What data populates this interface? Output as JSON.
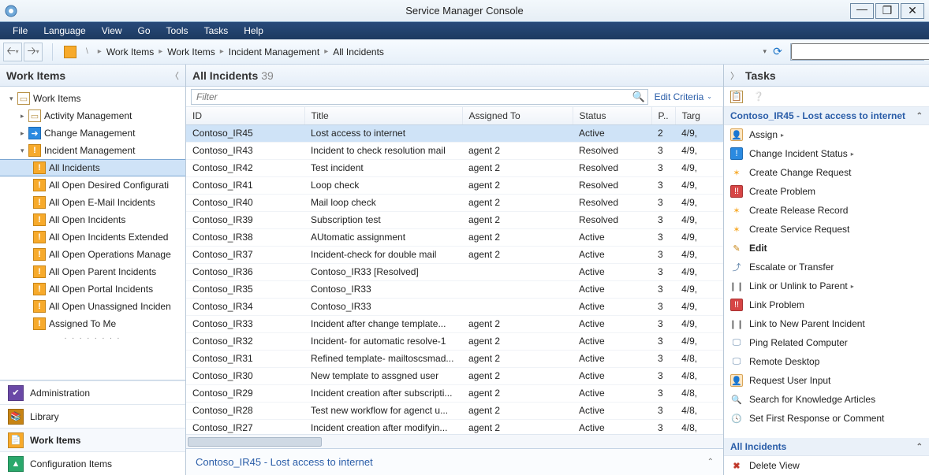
{
  "window": {
    "title": "Service Manager Console"
  },
  "menubar": [
    "File",
    "Language",
    "View",
    "Go",
    "Tools",
    "Tasks",
    "Help"
  ],
  "breadcrumb": [
    "Work Items",
    "Work Items",
    "Incident Management",
    "All Incidents"
  ],
  "leftpane": {
    "title": "Work Items",
    "tree_root": "Work Items",
    "tree_l2": [
      {
        "label": "Activity Management",
        "icon": "folder"
      },
      {
        "label": "Change Management",
        "icon": "blue"
      },
      {
        "label": "Incident Management",
        "icon": "orange"
      }
    ],
    "tree_l3": [
      {
        "label": "All Incidents",
        "selected": true
      },
      {
        "label": "All Open Desired Configurati"
      },
      {
        "label": "All Open E-Mail Incidents"
      },
      {
        "label": "All Open Incidents"
      },
      {
        "label": "All Open Incidents Extended"
      },
      {
        "label": "All Open Operations Manage"
      },
      {
        "label": "All Open Parent Incidents"
      },
      {
        "label": "All Open Portal Incidents"
      },
      {
        "label": "All Open Unassigned Inciden"
      },
      {
        "label": "Assigned To Me"
      }
    ],
    "wunderbar": [
      {
        "label": "Administration",
        "icon": "admin"
      },
      {
        "label": "Library",
        "icon": "library"
      },
      {
        "label": "Work Items",
        "icon": "work",
        "active": true
      },
      {
        "label": "Configuration Items",
        "icon": "config"
      }
    ]
  },
  "center": {
    "title": "All Incidents",
    "count": "39",
    "filter_placeholder": "Filter",
    "edit_criteria": "Edit Criteria",
    "columns": [
      "ID",
      "Title",
      "Assigned To",
      "Status",
      "P..",
      "Targ"
    ],
    "rows": [
      {
        "id": "Contoso_IR45",
        "title": "Lost access to internet",
        "assigned": "",
        "status": "Active",
        "p": "2",
        "targ": "4/9,",
        "sel": true
      },
      {
        "id": "Contoso_IR43",
        "title": "Incident to check resolution mail",
        "assigned": "agent 2",
        "status": "Resolved",
        "p": "3",
        "targ": "4/9,"
      },
      {
        "id": "Contoso_IR42",
        "title": "Test incident",
        "assigned": "agent 2",
        "status": "Resolved",
        "p": "3",
        "targ": "4/9,"
      },
      {
        "id": "Contoso_IR41",
        "title": "Loop check",
        "assigned": "agent 2",
        "status": "Resolved",
        "p": "3",
        "targ": "4/9,"
      },
      {
        "id": "Contoso_IR40",
        "title": "Mail loop check",
        "assigned": "agent 2",
        "status": "Resolved",
        "p": "3",
        "targ": "4/9,"
      },
      {
        "id": "Contoso_IR39",
        "title": "Subscription test",
        "assigned": "agent 2",
        "status": "Resolved",
        "p": "3",
        "targ": "4/9,"
      },
      {
        "id": "Contoso_IR38",
        "title": "AUtomatic assignment",
        "assigned": "agent 2",
        "status": "Active",
        "p": "3",
        "targ": "4/9,"
      },
      {
        "id": "Contoso_IR37",
        "title": "Incident-check for double mail",
        "assigned": "agent 2",
        "status": "Active",
        "p": "3",
        "targ": "4/9,"
      },
      {
        "id": "Contoso_IR36",
        "title": "Contoso_IR33 [Resolved]",
        "assigned": "",
        "status": "Active",
        "p": "3",
        "targ": "4/9,"
      },
      {
        "id": "Contoso_IR35",
        "title": "Contoso_IR33",
        "assigned": "",
        "status": "Active",
        "p": "3",
        "targ": "4/9,"
      },
      {
        "id": "Contoso_IR34",
        "title": "Contoso_IR33",
        "assigned": "",
        "status": "Active",
        "p": "3",
        "targ": "4/9,"
      },
      {
        "id": "Contoso_IR33",
        "title": "Incident after change template...",
        "assigned": "agent 2",
        "status": "Active",
        "p": "3",
        "targ": "4/9,"
      },
      {
        "id": "Contoso_IR32",
        "title": "Incident- for automatic resolve-1",
        "assigned": "agent 2",
        "status": "Active",
        "p": "3",
        "targ": "4/9,"
      },
      {
        "id": "Contoso_IR31",
        "title": "Refined template- mailtoscsmad...",
        "assigned": "agent 2",
        "status": "Active",
        "p": "3",
        "targ": "4/8,"
      },
      {
        "id": "Contoso_IR30",
        "title": "New template to assgned user",
        "assigned": "agent 2",
        "status": "Active",
        "p": "3",
        "targ": "4/8,"
      },
      {
        "id": "Contoso_IR29",
        "title": "Incident creation after subscripti...",
        "assigned": "agent 2",
        "status": "Active",
        "p": "3",
        "targ": "4/8,"
      },
      {
        "id": "Contoso_IR28",
        "title": "Test new workflow for agenct u...",
        "assigned": "agent 2",
        "status": "Active",
        "p": "3",
        "targ": "4/8,"
      },
      {
        "id": "Contoso_IR27",
        "title": "Incident creation after modifyin...",
        "assigned": "agent 2",
        "status": "Active",
        "p": "3",
        "targ": "4/8,"
      }
    ],
    "preview": "Contoso_IR45 - Lost access to internet"
  },
  "tasks": {
    "title": "Tasks",
    "section1_title": "Contoso_IR45 - Lost access to internet",
    "items": [
      {
        "label": "Assign",
        "icon": "user",
        "sub": true
      },
      {
        "label": "Change Incident Status",
        "icon": "info",
        "sub": true
      },
      {
        "label": "Create Change Request",
        "icon": "star"
      },
      {
        "label": "Create Problem",
        "icon": "red"
      },
      {
        "label": "Create Release Record",
        "icon": "star"
      },
      {
        "label": "Create Service Request",
        "icon": "star"
      },
      {
        "label": "Edit",
        "icon": "pencil",
        "bold": true
      },
      {
        "label": "Escalate or Transfer",
        "icon": "up"
      },
      {
        "label": "Link or Unlink to Parent",
        "icon": "link",
        "sub": true
      },
      {
        "label": "Link Problem",
        "icon": "red"
      },
      {
        "label": "Link to New Parent Incident",
        "icon": "link"
      },
      {
        "label": "Ping Related Computer",
        "icon": "monitor"
      },
      {
        "label": "Remote Desktop",
        "icon": "monitor"
      },
      {
        "label": "Request User Input",
        "icon": "user"
      },
      {
        "label": "Search for Knowledge Articles",
        "icon": "search"
      },
      {
        "label": "Set First Response or Comment",
        "icon": "clock"
      }
    ],
    "section2_title": "All Incidents",
    "items2": [
      {
        "label": "Delete View",
        "icon": "del"
      }
    ]
  }
}
